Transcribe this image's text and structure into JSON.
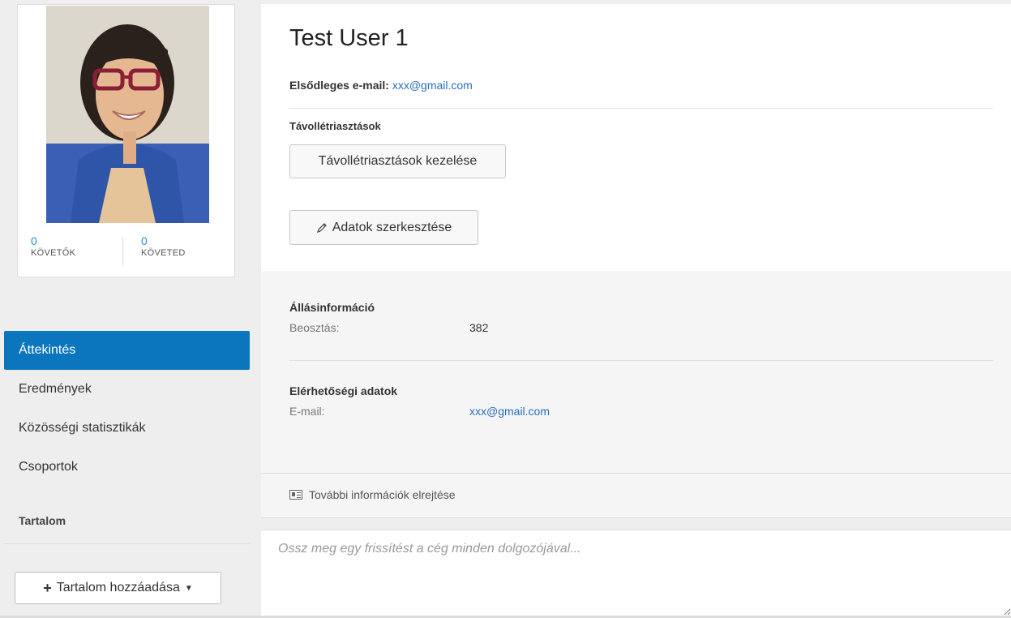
{
  "profile": {
    "avatar_alt": "avatar",
    "followers_count": "0",
    "followers_label": "KÖVETŐK",
    "following_count": "0",
    "following_label": "KÖVETED"
  },
  "nav": {
    "items": [
      {
        "label": "Áttekintés",
        "active": true
      },
      {
        "label": "Eredmények",
        "active": false
      },
      {
        "label": "Közösségi statisztikák",
        "active": false
      },
      {
        "label": "Csoportok",
        "active": false
      }
    ],
    "section_label": "Tartalom",
    "add_content_label": "Tartalom hozzáadása"
  },
  "user": {
    "name": "Test User 1",
    "primary_email_label": "Elsődleges e-mail:",
    "primary_email": "xxx@gmail.com"
  },
  "out_of_office": {
    "label": "Távollétriasztások",
    "manage_button": "Távollétriasztások kezelése"
  },
  "edit_button": "Adatok szerkesztése",
  "job_info": {
    "title": "Állásinformáció",
    "position_label": "Beosztás:",
    "position_value": "382"
  },
  "contact_info": {
    "title": "Elérhetőségi adatok",
    "email_label": "E-mail:",
    "email_value": "xxx@gmail.com"
  },
  "more_info_toggle": "További információk elrejtése",
  "share": {
    "placeholder": "Ossz meg egy frissítést a cég minden dolgozójával..."
  },
  "colors": {
    "accent": "#0b76be",
    "link": "#2a6ebb",
    "stat_number": "#2a8ad4"
  }
}
